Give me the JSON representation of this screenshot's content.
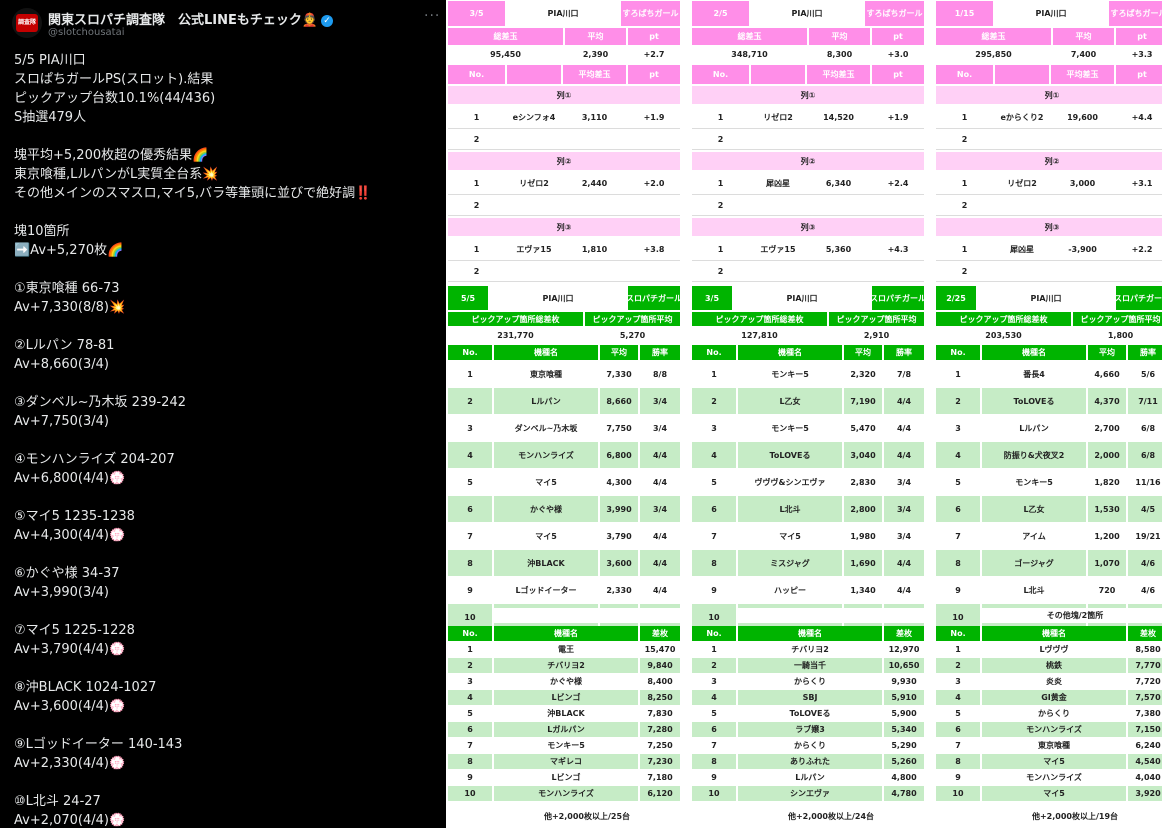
{
  "post": {
    "display_name": "関東スロパチ調査隊　公式LINEもチェック👲",
    "handle": "@slotchousatai",
    "lines": [
      "5/5 PIA川口",
      "スロぱちガールPS(スロット).結果",
      "ピックアップ台数10.1%(44/436)",
      "S抽選479人",
      "",
      "塊平均+5,200枚超の優秀結果🌈",
      "東京喰種,LルパンがL実質全台系💥",
      "その他メインのスマスロ,マイ5,バラ等筆頭に並びで絶好調‼️",
      "",
      "塊10箇所",
      "➡️Av+5,270枚🌈",
      "",
      "①東京喰種 66-73",
      "Av+7,330(8/8)💥",
      "",
      "②Lルパン 78-81",
      "Av+8,660(3/4)",
      "",
      "③ダンベル~乃木坂 239-242",
      "Av+7,750(3/4)",
      "",
      "④モンハンライズ 204-207",
      "Av+6,800(4/4)💮",
      "",
      "⑤マイ5 1235-1238",
      "Av+4,300(4/4)💮",
      "",
      "⑥かぐや様 34-37",
      "Av+3,990(3/4)",
      "",
      "⑦マイ5 1225-1228",
      "Av+3,790(4/4)💮",
      "",
      "⑧沖BLACK 1024-1027",
      "Av+3,600(4/4)💮",
      "",
      "⑨Lゴッドイーター 140-143",
      "Av+2,330(4/4)💮",
      "",
      "⑩L北斗 24-27",
      "Av+2,070(4/4)💮"
    ]
  },
  "history": [
    {
      "date": "3/5",
      "store": "PIA川口",
      "event": "すろぱちガール",
      "sum_headers": [
        "総差玉",
        "平均",
        "pt"
      ],
      "sum_values": [
        "95,450",
        "2,390",
        "+2.7"
      ],
      "col_headers": [
        "No.",
        "",
        "平均差玉",
        "pt"
      ],
      "groups": [
        {
          "label": "列①",
          "rows": [
            [
              "1",
              "eシンフォ4",
              "3,110",
              "+1.9"
            ],
            [
              "2",
              "",
              "",
              ""
            ]
          ]
        },
        {
          "label": "列②",
          "rows": [
            [
              "1",
              "リゼロ2",
              "2,440",
              "+2.0"
            ],
            [
              "2",
              "",
              "",
              ""
            ]
          ]
        },
        {
          "label": "列③",
          "rows": [
            [
              "1",
              "エヴァ15",
              "1,810",
              "+3.8"
            ],
            [
              "2",
              "",
              "",
              ""
            ]
          ]
        }
      ]
    },
    {
      "date": "2/5",
      "store": "PIA川口",
      "event": "すろぱちガール",
      "sum_headers": [
        "総差玉",
        "平均",
        "pt"
      ],
      "sum_values": [
        "348,710",
        "8,300",
        "+3.0"
      ],
      "col_headers": [
        "No.",
        "",
        "平均差玉",
        "pt"
      ],
      "groups": [
        {
          "label": "列①",
          "rows": [
            [
              "1",
              "リゼロ2",
              "14,520",
              "+1.9"
            ],
            [
              "2",
              "",
              "",
              ""
            ]
          ]
        },
        {
          "label": "列②",
          "rows": [
            [
              "1",
              "犀凶星",
              "6,340",
              "+2.4"
            ],
            [
              "2",
              "",
              "",
              ""
            ]
          ]
        },
        {
          "label": "列③",
          "rows": [
            [
              "1",
              "エヴァ15",
              "5,360",
              "+4.3"
            ],
            [
              "2",
              "",
              "",
              ""
            ]
          ]
        }
      ]
    },
    {
      "date": "1/15",
      "store": "PIA川口",
      "event": "すろぱちガール",
      "sum_headers": [
        "総差玉",
        "平均",
        "pt"
      ],
      "sum_values": [
        "295,850",
        "7,400",
        "+3.3"
      ],
      "col_headers": [
        "No.",
        "",
        "平均差玉",
        "pt"
      ],
      "groups": [
        {
          "label": "列①",
          "rows": [
            [
              "1",
              "eからくり2",
              "19,600",
              "+4.4"
            ],
            [
              "2",
              "",
              "",
              ""
            ]
          ]
        },
        {
          "label": "列②",
          "rows": [
            [
              "1",
              "リゼロ2",
              "3,000",
              "+3.1"
            ],
            [
              "2",
              "",
              "",
              ""
            ]
          ]
        },
        {
          "label": "列③",
          "rows": [
            [
              "1",
              "犀凶星",
              "-3,900",
              "+2.2"
            ],
            [
              "2",
              "",
              "",
              ""
            ]
          ]
        }
      ]
    }
  ],
  "results": [
    {
      "date": "5/5",
      "store": "PIA川口",
      "event": "スロパチガール",
      "sum_headers": [
        "ピックアップ箇所総差枚",
        "ピックアップ箇所平均"
      ],
      "sum_values": [
        "231,770",
        "5,270"
      ],
      "col_headers": [
        "No.",
        "機種名",
        "平均",
        "勝率"
      ],
      "rows": [
        [
          "1",
          "東京喰種",
          "7,330",
          "8/8"
        ],
        [
          "2",
          "Lルパン",
          "8,660",
          "3/4"
        ],
        [
          "3",
          "ダンベル~乃木坂",
          "7,750",
          "3/4"
        ],
        [
          "4",
          "モンハンライズ",
          "6,800",
          "4/4"
        ],
        [
          "5",
          "マイ5",
          "4,300",
          "4/4"
        ],
        [
          "6",
          "かぐや様",
          "3,990",
          "3/4"
        ],
        [
          "7",
          "マイ5",
          "3,790",
          "4/4"
        ],
        [
          "8",
          "沖BLACK",
          "3,600",
          "4/4"
        ],
        [
          "9",
          "Lゴッドイーター",
          "2,330",
          "4/4"
        ],
        [
          "10",
          "L北斗",
          "2,070",
          "4/4"
        ]
      ],
      "extra_label": "",
      "top_headers": [
        "No.",
        "機種名",
        "差枚"
      ],
      "top_rows": [
        [
          "1",
          "電王",
          "15,470"
        ],
        [
          "2",
          "チバリヨ2",
          "9,840"
        ],
        [
          "3",
          "かぐや様",
          "8,400"
        ],
        [
          "4",
          "Lビンゴ",
          "8,250"
        ],
        [
          "5",
          "沖BLACK",
          "7,830"
        ],
        [
          "6",
          "Lガルパン",
          "7,280"
        ],
        [
          "7",
          "モンキー5",
          "7,250"
        ],
        [
          "8",
          "マギレコ",
          "7,230"
        ],
        [
          "9",
          "Lビンゴ",
          "7,180"
        ],
        [
          "10",
          "モンハンライズ",
          "6,120"
        ]
      ],
      "footer": "他+2,000枚以上/25台"
    },
    {
      "date": "3/5",
      "store": "PIA川口",
      "event": "スロパチガール",
      "sum_headers": [
        "ピックアップ箇所総差枚",
        "ピックアップ箇所平均"
      ],
      "sum_values": [
        "127,810",
        "2,910"
      ],
      "col_headers": [
        "No.",
        "機種名",
        "平均",
        "勝率"
      ],
      "rows": [
        [
          "1",
          "モンキー5",
          "2,320",
          "7/8"
        ],
        [
          "2",
          "L乙女",
          "7,190",
          "4/4"
        ],
        [
          "3",
          "モンキー5",
          "5,470",
          "4/4"
        ],
        [
          "4",
          "ToLOVEる",
          "3,040",
          "4/4"
        ],
        [
          "5",
          "ヴヴヴ&シンエヴァ",
          "2,830",
          "3/4"
        ],
        [
          "6",
          "L北斗",
          "2,800",
          "3/4"
        ],
        [
          "7",
          "マイ5",
          "1,980",
          "3/4"
        ],
        [
          "8",
          "ミスジャグ",
          "1,690",
          "4/4"
        ],
        [
          "9",
          "ハッピー",
          "1,340",
          "4/4"
        ],
        [
          "10",
          "沖BLACK",
          "970",
          "2/4"
        ]
      ],
      "extra_label": "",
      "top_headers": [
        "No.",
        "機種名",
        "差枚"
      ],
      "top_rows": [
        [
          "1",
          "チバリヨ2",
          "12,970"
        ],
        [
          "2",
          "一騎当千",
          "10,650"
        ],
        [
          "3",
          "からくり",
          "9,930"
        ],
        [
          "4",
          "SBJ",
          "5,910"
        ],
        [
          "5",
          "ToLOVEる",
          "5,900"
        ],
        [
          "6",
          "ラブ嬢3",
          "5,340"
        ],
        [
          "7",
          "からくり",
          "5,290"
        ],
        [
          "8",
          "ありふれた",
          "5,260"
        ],
        [
          "9",
          "Lルパン",
          "4,800"
        ],
        [
          "10",
          "シンエヴァ",
          "4,780"
        ]
      ],
      "footer": "他+2,000枚以上/24台"
    },
    {
      "date": "2/25",
      "store": "PIA川口",
      "event": "スロパチガール",
      "sum_headers": [
        "ピックアップ箇所総差枚",
        "ピックアップ箇所平均"
      ],
      "sum_values": [
        "203,530",
        "1,800"
      ],
      "col_headers": [
        "No.",
        "機種名",
        "平均",
        "勝率"
      ],
      "rows": [
        [
          "1",
          "番長4",
          "4,660",
          "5/6"
        ],
        [
          "2",
          "ToLOVEる",
          "4,370",
          "7/11"
        ],
        [
          "3",
          "Lルパン",
          "2,700",
          "6/8"
        ],
        [
          "4",
          "防振り&犬夜叉2",
          "2,000",
          "6/8"
        ],
        [
          "5",
          "モンキー5",
          "1,820",
          "11/16"
        ],
        [
          "6",
          "L乙女",
          "1,530",
          "4/5"
        ],
        [
          "7",
          "アイム",
          "1,200",
          "19/21"
        ],
        [
          "8",
          "ゴージャグ",
          "1,070",
          "4/6"
        ],
        [
          "9",
          "L北斗",
          "720",
          "4/6"
        ],
        [
          "10",
          "ゴージャグ",
          "700",
          "14/20"
        ]
      ],
      "extra_label": "その他塊/2箇所",
      "top_headers": [
        "No.",
        "機種名",
        "差枚"
      ],
      "top_rows": [
        [
          "1",
          "Lヴヴヴ",
          "8,580"
        ],
        [
          "2",
          "桃鉄",
          "7,770"
        ],
        [
          "3",
          "炎炎",
          "7,720"
        ],
        [
          "4",
          "GI黄金",
          "7,570"
        ],
        [
          "5",
          "からくり",
          "7,380"
        ],
        [
          "6",
          "モンハンライズ",
          "7,150"
        ],
        [
          "7",
          "東京喰種",
          "6,240"
        ],
        [
          "8",
          "マイ5",
          "4,540"
        ],
        [
          "9",
          "モンハンライズ",
          "4,040"
        ],
        [
          "10",
          "マイ5",
          "3,920"
        ]
      ],
      "footer": "他+2,000枚以上/19台"
    }
  ]
}
